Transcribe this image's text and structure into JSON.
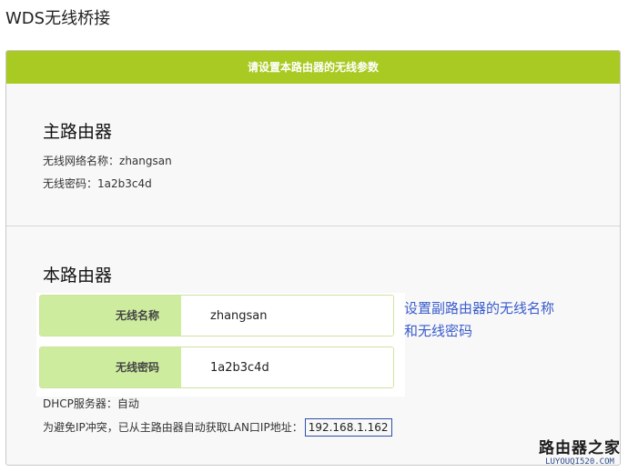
{
  "page": {
    "title": "WDS无线桥接"
  },
  "panel": {
    "header": "请设置本路由器的无线参数"
  },
  "main_router": {
    "title": "主路由器",
    "ssid_label": "无线网络名称：",
    "ssid_value": "zhangsan",
    "pwd_label": "无线密码：",
    "pwd_value": "1a2b3c4d"
  },
  "local_router": {
    "title": "本路由器",
    "ssid_label": "无线名称",
    "ssid_value": "zhangsan",
    "pwd_label": "无线密码",
    "pwd_value": "1a2b3c4d",
    "hint": "设置副路由器的无线名称和无线密码",
    "dhcp_label": "DHCP服务器：",
    "dhcp_value": "自动",
    "ip_label": "为避免IP冲突，已从主路由器自动获取LAN口IP地址：",
    "ip_value": "192.168.1.162"
  },
  "watermark": {
    "cn": "路由器之家",
    "en": "LUYOUQI520.COM"
  },
  "colors": {
    "header_green": "#a9ca22",
    "label_green": "#cdec9e",
    "hint_blue": "#3a5ccc"
  }
}
